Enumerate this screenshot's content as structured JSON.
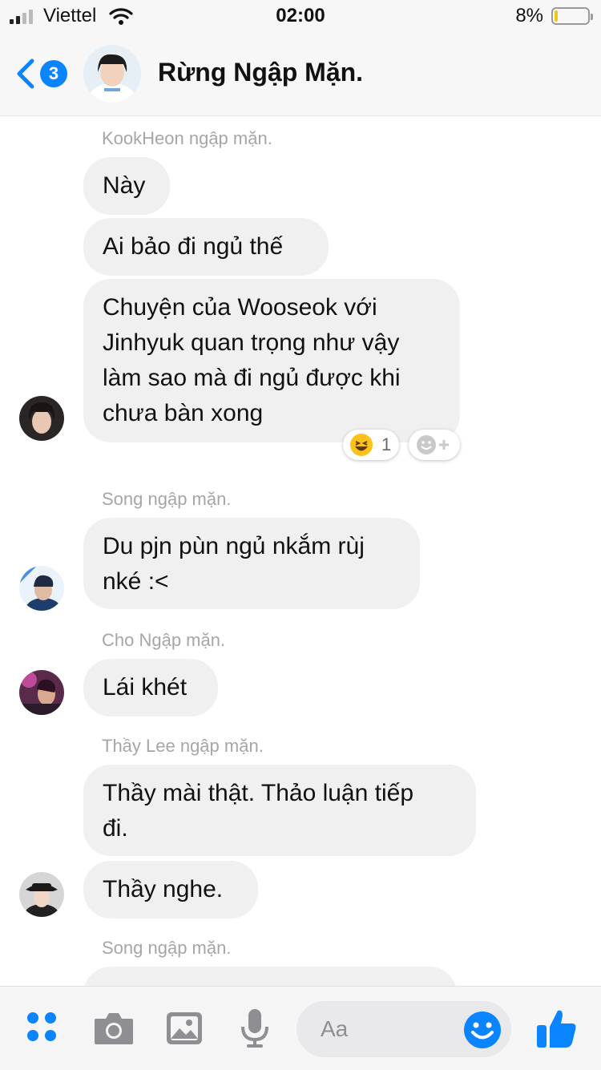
{
  "status_bar": {
    "carrier": "Viettel",
    "time": "02:00",
    "battery": "8%",
    "battery_level": 0.08
  },
  "header": {
    "back_badge": "3",
    "title": "Rừng Ngập Mặn."
  },
  "messages": {
    "group1_sender": "KookHeon ngập mặn.",
    "group1_m1": "Này",
    "group1_m2": "Ai bảo đi ngủ thế",
    "group1_m3": "Chuyện của Wooseok với\nJinhyuk quan trọng như vậy\nlàm sao mà đi ngủ được khi\nchưa bàn xong",
    "reaction_count": "1",
    "group2_sender": "Song ngập mặn.",
    "group2_m1": "Du pjn pùn ngủ nkắm rùj\nnké :<",
    "group3_sender": "Cho Ngập mặn.",
    "group3_m1": "Lái khét",
    "group4_sender": "Thầy Lee ngập mặn.",
    "group4_m1": "Thầy mài thật. Thảo luận tiếp\nđi.",
    "group4_m2": "Thầy nghe.",
    "group5_sender": "Song ngập mặn."
  },
  "composer": {
    "placeholder": "Aa"
  },
  "colors": {
    "accent": "#0b84ff",
    "bubble": "#f1f0f0",
    "sender_text": "#a6a6a6",
    "battery_fill": "#f0c419"
  },
  "icons": [
    "signal-icon",
    "wifi-icon",
    "battery-icon",
    "back-chevron-icon",
    "menu-dots-icon",
    "camera-icon",
    "image-icon",
    "microphone-icon",
    "emoji-icon",
    "thumbs-up-icon",
    "laughing-emoji-icon",
    "add-reaction-icon"
  ]
}
